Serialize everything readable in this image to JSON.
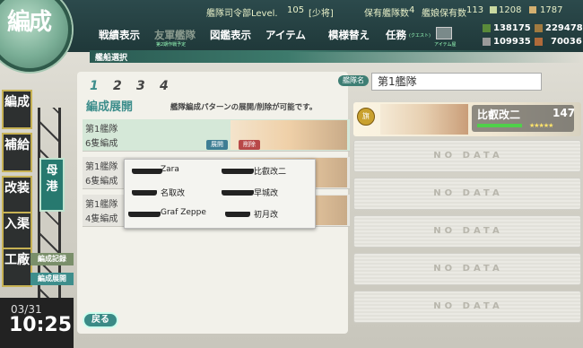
{
  "header": {
    "rank_label": "艦隊司令部Level.",
    "level": "105",
    "rank": "[少将]",
    "ships_label": "保有艦隊数",
    "ships_value": "4",
    "shipgirl_label": "艦娘保有数",
    "shipgirl_value": "113",
    "res_top1": "1208",
    "res_top2": "1787"
  },
  "menu": {
    "items": [
      "戦績表示",
      "友軍艦隊",
      "図鑑表示",
      "アイテム",
      "模様替え",
      "任務"
    ],
    "friend_sub": "第2期作戦予定",
    "quest_sub": "(クエスト)",
    "item_store": "アイテム屋"
  },
  "resources": {
    "fuel": "138175",
    "ammo": "229478",
    "steel": "109935",
    "bauxite": "70036"
  },
  "emblem": {
    "text": "編成"
  },
  "sidebar": {
    "items": [
      "編成",
      "補給",
      "改装",
      "入渠",
      "工廠"
    ],
    "port": "母港",
    "sub_record": "編成記録",
    "sub_expand": "編成展開",
    "date": "03/31",
    "time": "10:25"
  },
  "title_strip": "艦船選択",
  "pages": [
    "1",
    "2",
    "3",
    "4"
  ],
  "expand": {
    "title": "編成展開",
    "desc": "艦隊編成パターンの展開/削除が可能です。"
  },
  "presets": [
    {
      "name": "第1艦隊",
      "count": "6隻編成"
    },
    {
      "name": "第1艦隊",
      "count": "6隻編成"
    },
    {
      "name": "第1艦隊",
      "count": "4隻編成"
    }
  ],
  "buttons": {
    "expand": "展開",
    "delete": "削除",
    "back": "戻る"
  },
  "dropdown": {
    "ships": [
      "Zara",
      "比叡改二",
      "名取改",
      "早城改",
      "Graf Zeppe",
      "初月改"
    ]
  },
  "fleet": {
    "label": "艦隊名",
    "name": "第1艦隊"
  },
  "ship1": {
    "name": "比叡改二",
    "level": "147",
    "stars": "★★★★★"
  },
  "nodata": "NO DATA"
}
